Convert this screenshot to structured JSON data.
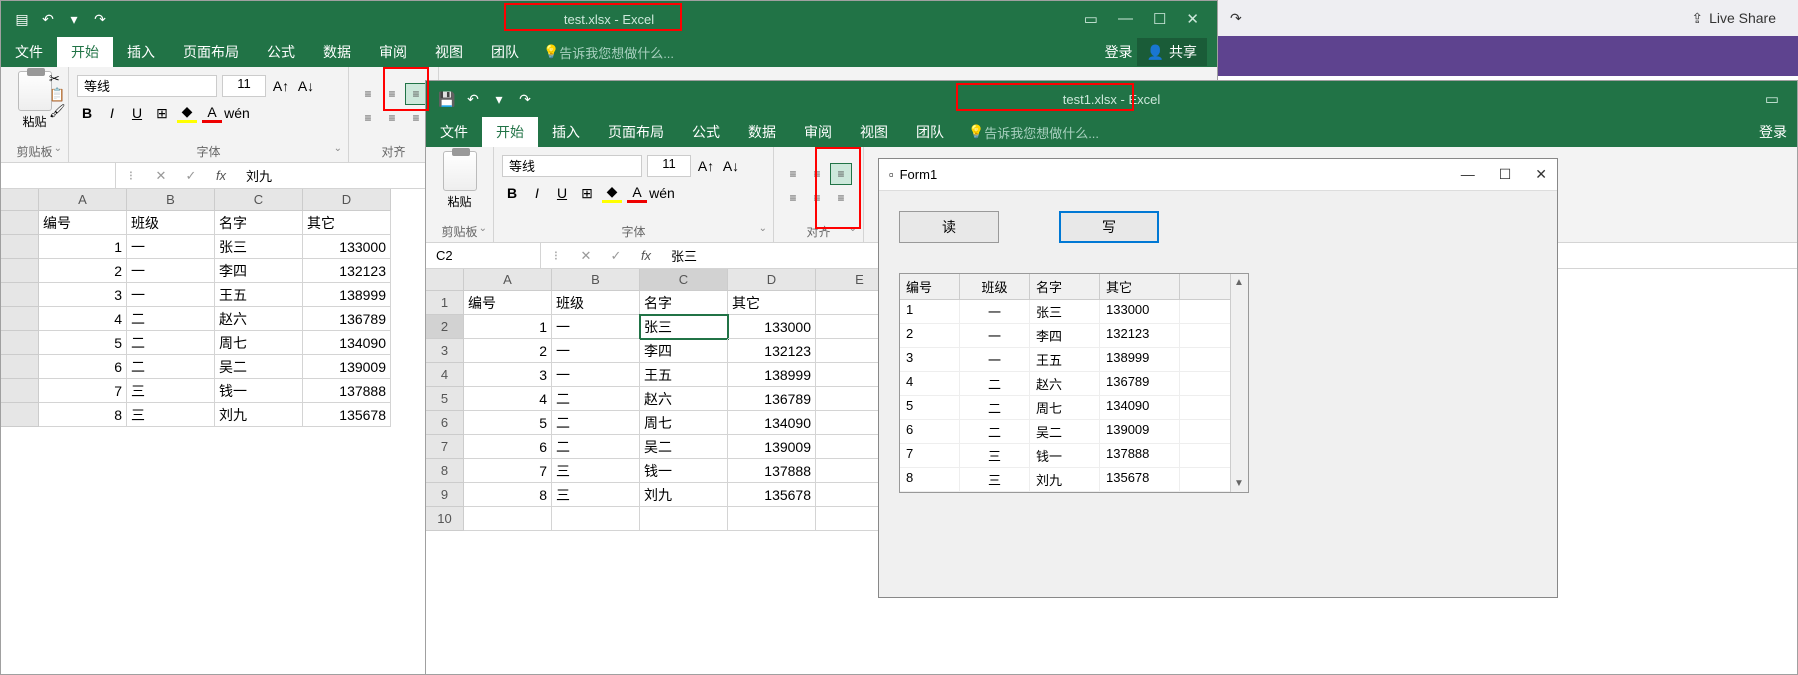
{
  "excel1": {
    "title": "test.xlsx - Excel",
    "qat": {
      "save": "💾",
      "undo": "↶",
      "redo": "↷"
    },
    "tabs": [
      "文件",
      "开始",
      "插入",
      "页面布局",
      "公式",
      "数据",
      "审阅",
      "视图",
      "团队"
    ],
    "active_tab": 1,
    "tellme": "告诉我您想做什么...",
    "login": "登录",
    "share": "共享",
    "ribbon": {
      "paste_label": "粘贴",
      "clipboard_label": "剪贴板",
      "font_label": "字体",
      "align_label": "对齐",
      "font_name": "等线",
      "font_size": "11"
    },
    "namebox": "",
    "formula_value": "刘九",
    "cols": [
      "A",
      "B",
      "C",
      "D"
    ],
    "headers": [
      "编号",
      "班级",
      "名字",
      "其它"
    ],
    "rows": [
      [
        "1",
        "一",
        "张三",
        "133000"
      ],
      [
        "2",
        "一",
        "李四",
        "132123"
      ],
      [
        "3",
        "一",
        "王五",
        "138999"
      ],
      [
        "4",
        "二",
        "赵六",
        "136789"
      ],
      [
        "5",
        "二",
        "周七",
        "134090"
      ],
      [
        "6",
        "二",
        "吴二",
        "139009"
      ],
      [
        "7",
        "三",
        "钱一",
        "137888"
      ],
      [
        "8",
        "三",
        "刘九",
        "135678"
      ]
    ]
  },
  "excel2": {
    "title": "test1.xlsx - Excel",
    "tabs": [
      "文件",
      "开始",
      "插入",
      "页面布局",
      "公式",
      "数据",
      "审阅",
      "视图",
      "团队"
    ],
    "active_tab": 1,
    "tellme": "告诉我您想做什么...",
    "login": "登录",
    "ribbon": {
      "paste_label": "粘贴",
      "clipboard_label": "剪贴板",
      "font_label": "字体",
      "align_label": "对齐",
      "font_name": "等线",
      "font_size": "11"
    },
    "namebox": "C2",
    "formula_value": "张三",
    "cols": [
      "A",
      "B",
      "C",
      "D",
      "E"
    ],
    "headers": [
      "编号",
      "班级",
      "名字",
      "其它"
    ],
    "rows": [
      [
        "1",
        "一",
        "张三",
        "133000"
      ],
      [
        "2",
        "一",
        "李四",
        "132123"
      ],
      [
        "3",
        "一",
        "王五",
        "138999"
      ],
      [
        "4",
        "二",
        "赵六",
        "136789"
      ],
      [
        "5",
        "二",
        "周七",
        "134090"
      ],
      [
        "6",
        "二",
        "吴二",
        "139009"
      ],
      [
        "7",
        "三",
        "钱一",
        "137888"
      ],
      [
        "8",
        "三",
        "刘九",
        "135678"
      ]
    ],
    "active_cell": {
      "row": 2,
      "col": 2
    }
  },
  "form1": {
    "title": "Form1",
    "read_btn": "读",
    "write_btn": "写",
    "headers": [
      "编号",
      "班级",
      "名字",
      "其它"
    ],
    "rows": [
      [
        "1",
        "一",
        "张三",
        "133000"
      ],
      [
        "2",
        "一",
        "李四",
        "132123"
      ],
      [
        "3",
        "一",
        "王五",
        "138999"
      ],
      [
        "4",
        "二",
        "赵六",
        "136789"
      ],
      [
        "5",
        "二",
        "周七",
        "134090"
      ],
      [
        "6",
        "二",
        "吴二",
        "139009"
      ],
      [
        "7",
        "三",
        "钱一",
        "137888"
      ],
      [
        "8",
        "三",
        "刘九",
        "135678"
      ]
    ]
  },
  "vs": {
    "live_share": "Live Share",
    "redo": "↷"
  }
}
